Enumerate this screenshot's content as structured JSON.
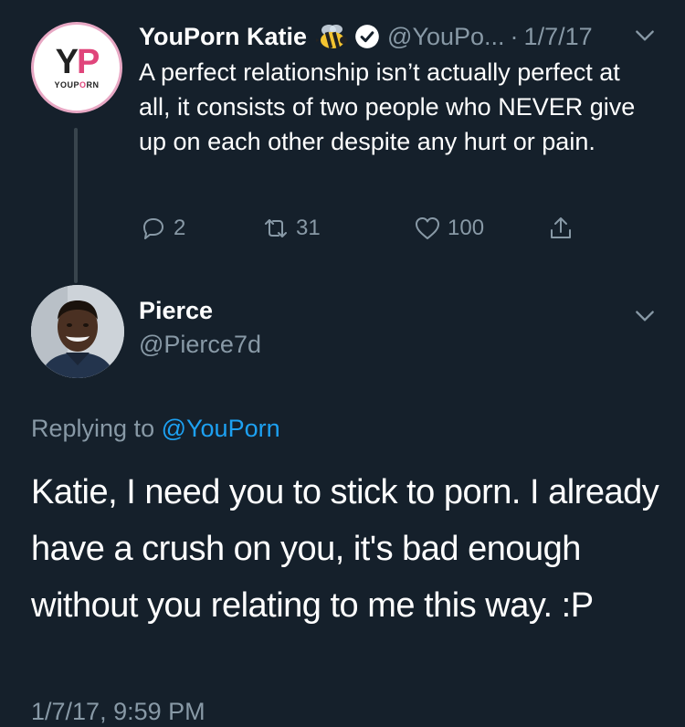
{
  "original_tweet": {
    "avatar": {
      "monogram_y": "Y",
      "monogram_p": "P",
      "wordmark_start": "YOUP",
      "wordmark_pink": "O",
      "wordmark_end": "RN"
    },
    "display_name": "YouPorn Katie",
    "handle": "@YouPo...",
    "separator": "·",
    "date": "1/7/17",
    "text": "A perfect relationship isn’t actually perfect at all, it consists of two people who NEVER give up on each other despite any hurt or pain.",
    "actions": {
      "replies": "2",
      "retweets": "31",
      "likes": "100"
    },
    "icons": [
      "bee-icon",
      "verified-badge-icon",
      "chevron-down-icon",
      "reply-icon",
      "retweet-icon",
      "like-icon",
      "share-icon"
    ]
  },
  "reply_tweet": {
    "display_name": "Pierce",
    "handle": "@Pierce7d",
    "replying_prefix": "Replying to ",
    "replying_to": "@YouPorn",
    "text": "Katie, I need you to stick to porn. I already have a crush on you, it's bad enough without you relating to me this way. :P",
    "timestamp": "1/7/17, 9:59 PM"
  },
  "colors": {
    "background": "#15202b",
    "text_primary": "#ffffff",
    "text_secondary": "#8899a6",
    "link": "#1da1f2",
    "thread_line": "#38444d",
    "brand_pink": "#e0457b"
  }
}
